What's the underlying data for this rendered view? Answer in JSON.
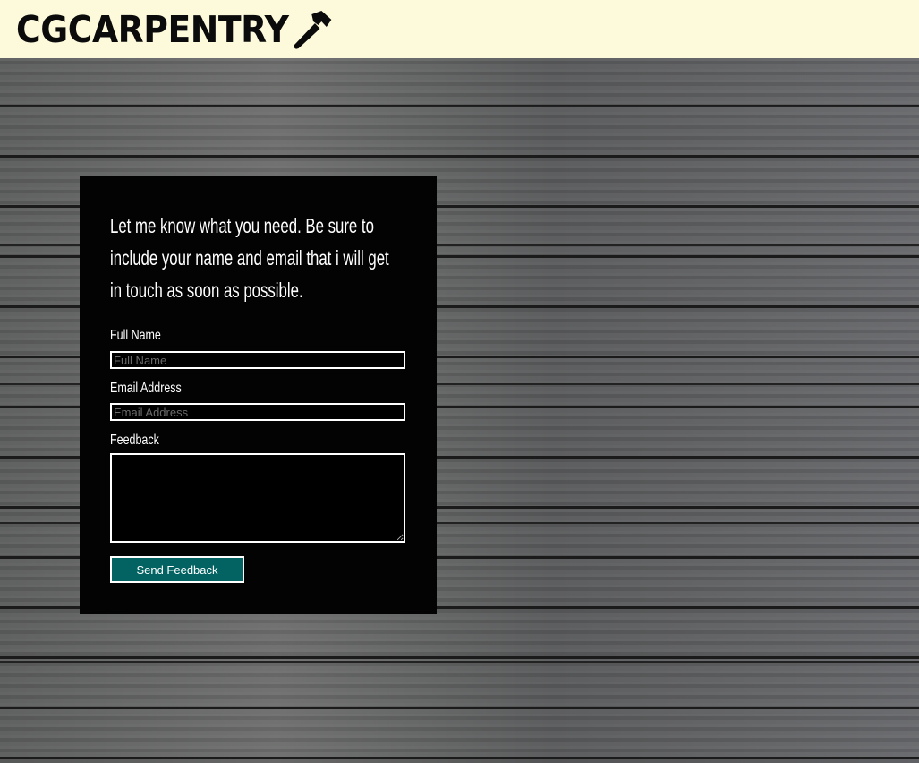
{
  "header": {
    "brand": "CGCARPENTRY",
    "brand_icon": "hammer-icon",
    "background": "#fdfadc"
  },
  "form": {
    "intro": "Let me know what you need. Be sure to include your name and email that i will get in touch as soon as possible.",
    "full_name_label": "Full Name",
    "full_name_placeholder": "Full Name",
    "email_label": "Email Address",
    "email_placeholder": "Email Address",
    "feedback_label": "Feedback",
    "submit_label": "Send Feedback",
    "submit_color": "#036363"
  }
}
